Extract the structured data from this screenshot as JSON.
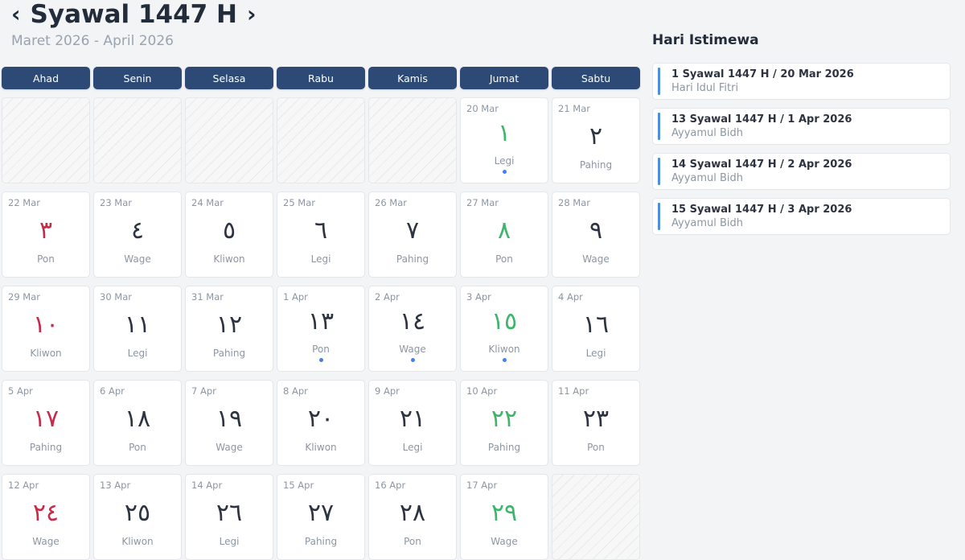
{
  "header": {
    "prev_arrow": "‹",
    "next_arrow": "›",
    "title": "Syawal 1447 H",
    "subtitle": "Maret 2026 - April 2026"
  },
  "weekdays": [
    "Ahad",
    "Senin",
    "Selasa",
    "Rabu",
    "Kamis",
    "Jumat",
    "Sabtu"
  ],
  "days": [
    {
      "empty": true
    },
    {
      "empty": true
    },
    {
      "empty": true
    },
    {
      "empty": true
    },
    {
      "empty": true
    },
    {
      "greg": "20 Mar",
      "hijri": "١",
      "pasaran": "Legi",
      "color": "green",
      "event": true
    },
    {
      "greg": "21 Mar",
      "hijri": "٢",
      "pasaran": "Pahing",
      "color": "default",
      "event": false
    },
    {
      "greg": "22 Mar",
      "hijri": "٣",
      "pasaran": "Pon",
      "color": "red",
      "event": false
    },
    {
      "greg": "23 Mar",
      "hijri": "٤",
      "pasaran": "Wage",
      "color": "default",
      "event": false
    },
    {
      "greg": "24 Mar",
      "hijri": "٥",
      "pasaran": "Kliwon",
      "color": "default",
      "event": false
    },
    {
      "greg": "25 Mar",
      "hijri": "٦",
      "pasaran": "Legi",
      "color": "default",
      "event": false
    },
    {
      "greg": "26 Mar",
      "hijri": "٧",
      "pasaran": "Pahing",
      "color": "default",
      "event": false
    },
    {
      "greg": "27 Mar",
      "hijri": "٨",
      "pasaran": "Pon",
      "color": "green",
      "event": false
    },
    {
      "greg": "28 Mar",
      "hijri": "٩",
      "pasaran": "Wage",
      "color": "default",
      "event": false
    },
    {
      "greg": "29 Mar",
      "hijri": "١٠",
      "pasaran": "Kliwon",
      "color": "red",
      "event": false
    },
    {
      "greg": "30 Mar",
      "hijri": "١١",
      "pasaran": "Legi",
      "color": "default",
      "event": false
    },
    {
      "greg": "31 Mar",
      "hijri": "١٢",
      "pasaran": "Pahing",
      "color": "default",
      "event": false
    },
    {
      "greg": "1 Apr",
      "hijri": "١٣",
      "pasaran": "Pon",
      "color": "default",
      "event": true
    },
    {
      "greg": "2 Apr",
      "hijri": "١٤",
      "pasaran": "Wage",
      "color": "default",
      "event": true
    },
    {
      "greg": "3 Apr",
      "hijri": "١٥",
      "pasaran": "Kliwon",
      "color": "green",
      "event": true
    },
    {
      "greg": "4 Apr",
      "hijri": "١٦",
      "pasaran": "Legi",
      "color": "default",
      "event": false
    },
    {
      "greg": "5 Apr",
      "hijri": "١٧",
      "pasaran": "Pahing",
      "color": "red",
      "event": false
    },
    {
      "greg": "6 Apr",
      "hijri": "١٨",
      "pasaran": "Pon",
      "color": "default",
      "event": false
    },
    {
      "greg": "7 Apr",
      "hijri": "١٩",
      "pasaran": "Wage",
      "color": "default",
      "event": false
    },
    {
      "greg": "8 Apr",
      "hijri": "٢٠",
      "pasaran": "Kliwon",
      "color": "default",
      "event": false
    },
    {
      "greg": "9 Apr",
      "hijri": "٢١",
      "pasaran": "Legi",
      "color": "default",
      "event": false
    },
    {
      "greg": "10 Apr",
      "hijri": "٢٢",
      "pasaran": "Pahing",
      "color": "green",
      "event": false
    },
    {
      "greg": "11 Apr",
      "hijri": "٢٣",
      "pasaran": "Pon",
      "color": "default",
      "event": false
    },
    {
      "greg": "12 Apr",
      "hijri": "٢٤",
      "pasaran": "Wage",
      "color": "red",
      "event": false
    },
    {
      "greg": "13 Apr",
      "hijri": "٢٥",
      "pasaran": "Kliwon",
      "color": "default",
      "event": false
    },
    {
      "greg": "14 Apr",
      "hijri": "٢٦",
      "pasaran": "Legi",
      "color": "default",
      "event": false
    },
    {
      "greg": "15 Apr",
      "hijri": "٢٧",
      "pasaran": "Pahing",
      "color": "default",
      "event": false
    },
    {
      "greg": "16 Apr",
      "hijri": "٢٨",
      "pasaran": "Pon",
      "color": "default",
      "event": false
    },
    {
      "greg": "17 Apr",
      "hijri": "٢٩",
      "pasaran": "Wage",
      "color": "green",
      "event": false
    },
    {
      "empty": true
    }
  ],
  "special_days": {
    "title": "Hari Istimewa",
    "items": [
      {
        "date": "1 Syawal 1447 H / 20 Mar 2026",
        "name": "Hari Idul Fitri"
      },
      {
        "date": "13 Syawal 1447 H / 1 Apr 2026",
        "name": "Ayyamul Bidh"
      },
      {
        "date": "14 Syawal 1447 H / 2 Apr 2026",
        "name": "Ayyamul Bidh"
      },
      {
        "date": "15 Syawal 1447 H / 3 Apr 2026",
        "name": "Ayyamul Bidh"
      }
    ]
  },
  "colors": {
    "header_bar": "#2c4a75",
    "sunday_red": "#c72b4a",
    "friday_green": "#3eb56a",
    "event_dot": "#3b82f6",
    "event_bar": "#4c8fe0"
  }
}
